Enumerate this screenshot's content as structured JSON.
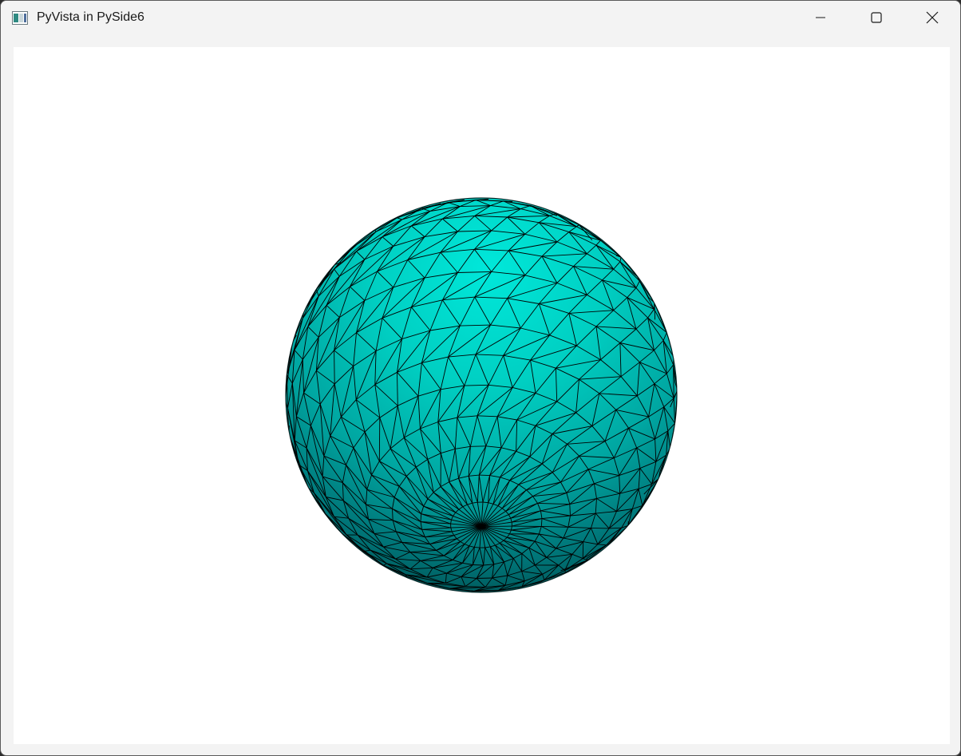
{
  "window": {
    "title": "PyVista in PySide6",
    "controls": {
      "minimize": "minimize",
      "maximize": "maximize",
      "close": "close"
    }
  },
  "scene": {
    "background": "#ffffff",
    "object": "sphere",
    "mesh_color": "#00d4c6",
    "shade_dark": "#005a5e",
    "edge_color": "#000000",
    "show_edges": true,
    "latitude_bands": 20,
    "longitude_segments": 36
  }
}
